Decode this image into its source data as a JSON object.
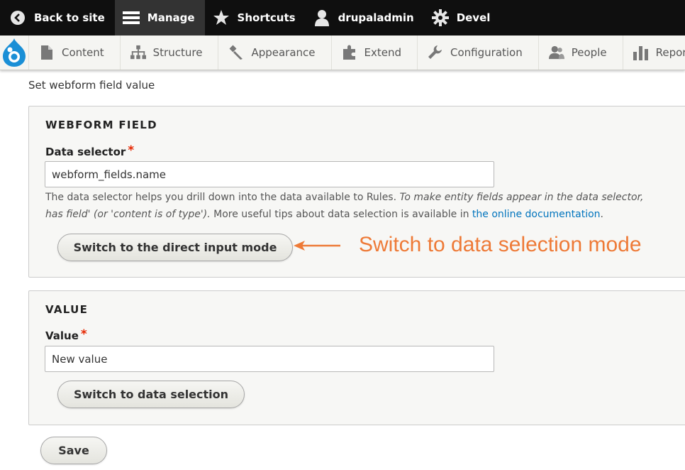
{
  "toolbar": {
    "back_to_site": "Back to site",
    "manage": "Manage",
    "shortcuts": "Shortcuts",
    "user": "drupaladmin",
    "devel": "Devel"
  },
  "tray": {
    "content": "Content",
    "structure": "Structure",
    "appearance": "Appearance",
    "extend": "Extend",
    "configuration": "Configuration",
    "people": "People",
    "reports": "Reports"
  },
  "page": {
    "heading": "Set webform field value"
  },
  "webform_field": {
    "legend": "WEBFORM FIELD",
    "label": "Data selector",
    "required_mark": "*",
    "value": "webform_fields.name",
    "desc_line1_plain": "The data selector helps you drill down into the data available to Rules. ",
    "desc_line1_italic": "To make entity fields appear in the data selector,",
    "desc_line2_italic": "has field' (or 'content is of type').",
    "desc_line2_plain": " More useful tips about data selection is available in ",
    "desc_link": "the online documentation",
    "desc_end": ".",
    "button": "Switch to the direct input mode"
  },
  "value_field": {
    "legend": "VALUE",
    "label": "Value",
    "required_mark": "*",
    "value": "New value",
    "button": "Switch to data selection"
  },
  "save_button": "Save",
  "annotation": {
    "text": "Switch to data selection mode",
    "color": "#ee7a37"
  },
  "colors": {
    "toolbar_bg": "#0f0f0f",
    "link": "#0074bd",
    "required": "#e62600"
  }
}
